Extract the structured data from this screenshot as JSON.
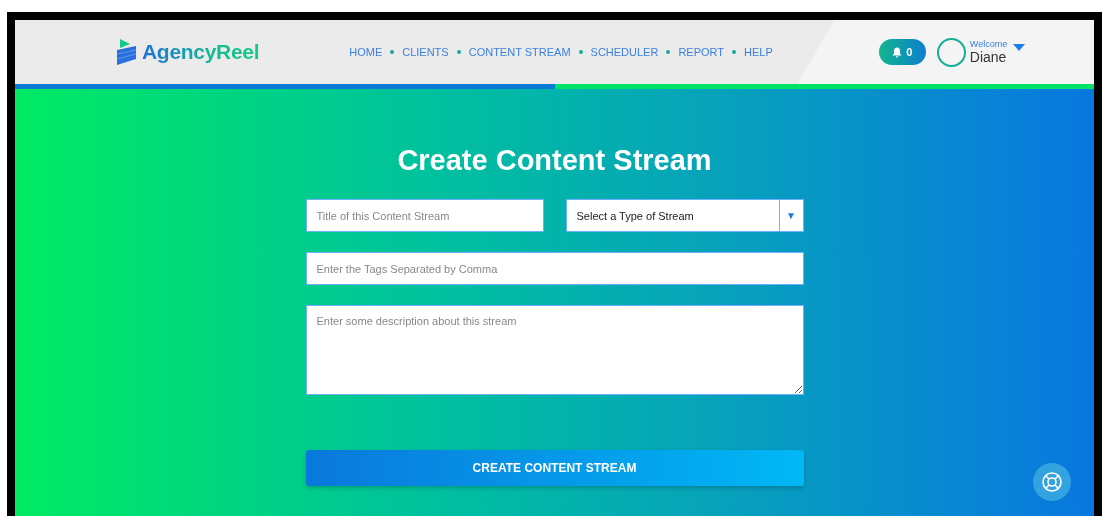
{
  "header": {
    "brand": "AgencyReel",
    "nav": [
      {
        "label": "HOME"
      },
      {
        "label": "CLIENTS"
      },
      {
        "label": "CONTENT STREAM"
      },
      {
        "label": "SCHEDULER"
      },
      {
        "label": "REPORT"
      },
      {
        "label": "HELP"
      }
    ],
    "notifications": {
      "count": "0"
    },
    "user": {
      "greeting": "Welcome",
      "name": "Diane"
    }
  },
  "progress": {
    "level": 0.5
  },
  "form": {
    "title": "Create Content Stream",
    "fields": [
      {
        "kind": "input",
        "placeholder": "Title of this Content Stream"
      },
      {
        "kind": "select",
        "value": "Select a Type of Stream",
        "arrow": "▼"
      },
      {
        "kind": "input",
        "placeholder": "Enter the Tags Separated by Comma"
      },
      {
        "kind": "textarea",
        "placeholder": "Enter some description about this stream"
      }
    ],
    "submit": "CREATE CONTENT STREAM"
  }
}
